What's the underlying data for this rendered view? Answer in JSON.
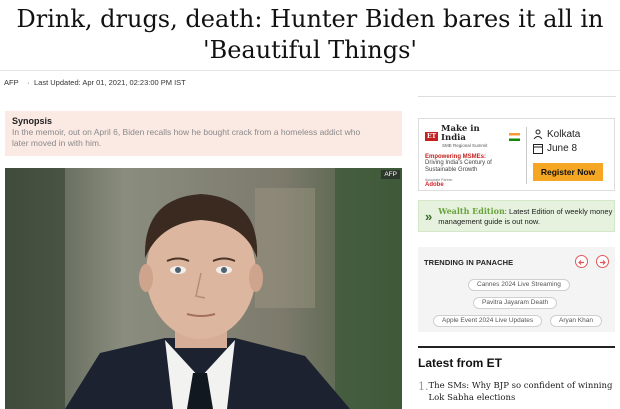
{
  "article": {
    "headline_line1": "Drink, drugs, death: Hunter Biden bares it all in",
    "headline_line2": "'Beautiful Things'",
    "source": "AFP",
    "separator": "·",
    "updated": "Last Updated: Apr 01, 2021, 02:23:00 PM IST",
    "synopsis_title": "Synopsis",
    "synopsis_text": "In the memoir, out on April 6, Biden recalls how he bought crack from a homeless addict who later moved in with him.",
    "photo_credit": "AFP"
  },
  "ad": {
    "et_logo": "ET",
    "brand": "Make in India",
    "brand_sub": "SME Regional Summit",
    "empowering": "Empowering MSMEs:",
    "desc": "Driving India's Century of Sustainable Growth",
    "partner": "Associate Partner",
    "adobe": "Adobe",
    "city": "Kolkata",
    "date": "June 8",
    "register": "Register Now"
  },
  "wealth": {
    "arrow": "»",
    "brand": "Wealth Edition",
    "text": ": Latest Edition of weekly money management guide is out now."
  },
  "trending": {
    "title": "TRENDING IN PANACHE",
    "tags": [
      "Cannes 2024 Live Streaming",
      "Pavitra Jayaram Death",
      "Apple Event 2024 Live Updates",
      "Aryan Khan"
    ]
  },
  "latest": {
    "title": "Latest from ET",
    "items": [
      {
        "num": "1.",
        "text": "The SMs: Why BJP so confident of winning Lok Sabha elections"
      }
    ]
  },
  "colors": {
    "accent_red": "#c5221f",
    "synopsis_bg": "#fbe9e3",
    "register_bg": "#f5a623",
    "wealth_bg": "#e6f1de"
  }
}
